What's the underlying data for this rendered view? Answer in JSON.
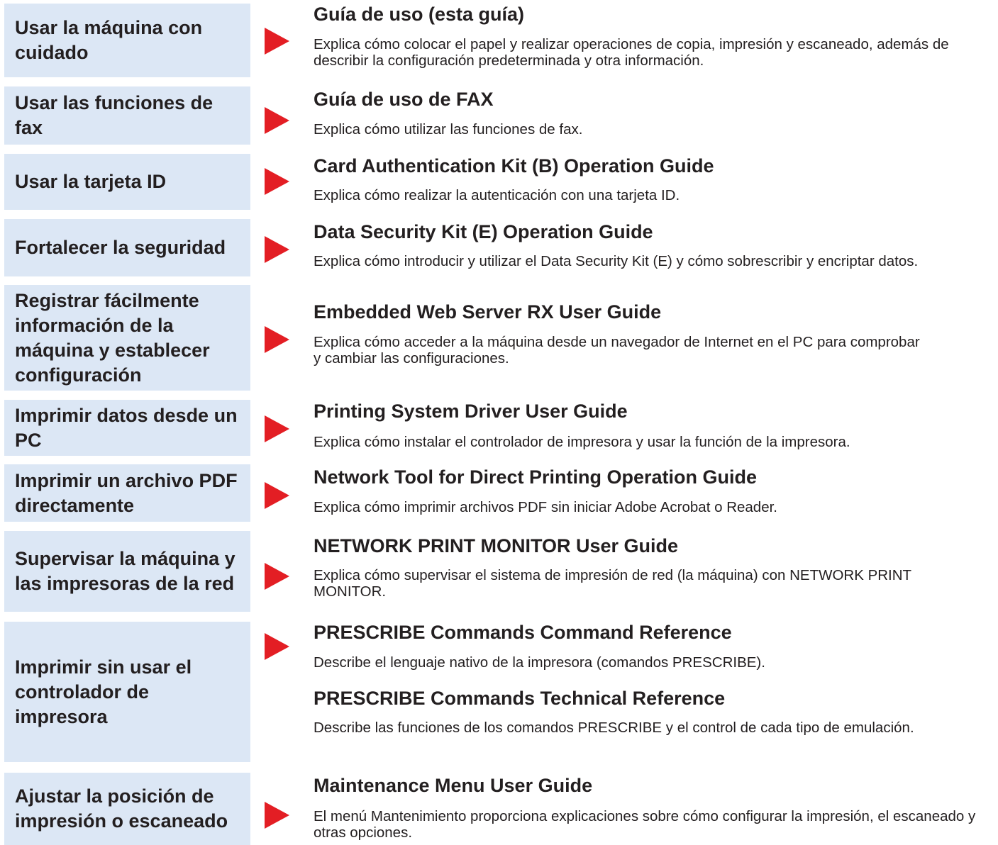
{
  "rows": [
    {
      "task": "Usar la máquina con cuidado",
      "guides": [
        {
          "title": "Guía de uso (esta guía)",
          "desc": "Explica cómo colocar el papel y realizar operaciones de copia, impresión y escaneado, además de describir la configuración predeterminada y otra información."
        }
      ]
    },
    {
      "task": "Usar las funciones de fax",
      "guides": [
        {
          "title": "Guía de uso de FAX",
          "desc": "Explica cómo utilizar las funciones de fax."
        }
      ]
    },
    {
      "task": "Usar la tarjeta ID",
      "guides": [
        {
          "title": "Card Authentication Kit (B) Operation Guide",
          "desc": "Explica cómo realizar la autenticación con una tarjeta ID."
        }
      ]
    },
    {
      "task": "Fortalecer la seguridad",
      "guides": [
        {
          "title": "Data Security Kit (E) Operation Guide",
          "desc": "Explica cómo introducir y utilizar el Data Security Kit (E) y cómo sobrescribir y encriptar datos."
        }
      ]
    },
    {
      "task": "Registrar fácilmente información de la máquina y establecer configuración",
      "guides": [
        {
          "title": "Embedded Web Server RX User Guide",
          "desc": "Explica cómo acceder a la máquina desde un navegador de Internet en el PC para comprobar y cambiar las configuraciones."
        }
      ]
    },
    {
      "task": "Imprimir datos desde un PC",
      "guides": [
        {
          "title": "Printing System Driver User Guide",
          "desc": "Explica cómo instalar el controlador de impresora y usar la función de la impresora."
        }
      ]
    },
    {
      "task": "Imprimir un archivo PDF directamente",
      "guides": [
        {
          "title": "Network Tool for Direct Printing Operation Guide",
          "desc": "Explica cómo imprimir archivos PDF sin iniciar Adobe Acrobat o Reader."
        }
      ]
    },
    {
      "task": "Supervisar la máquina y las impresoras de la red",
      "guides": [
        {
          "title": "NETWORK PRINT MONITOR User Guide",
          "desc": "Explica cómo supervisar el sistema de impresión de red (la máquina) con NETWORK PRINT MONITOR."
        }
      ]
    },
    {
      "task": "Imprimir sin usar el controlador de impresora",
      "guides": [
        {
          "title": "PRESCRIBE Commands Command Reference",
          "desc": "Describe el lenguaje nativo de la impresora (comandos PRESCRIBE)."
        },
        {
          "title": "PRESCRIBE Commands Technical Reference",
          "desc": "Describe las funciones de los comandos PRESCRIBE y el control de cada tipo de emulación."
        }
      ]
    },
    {
      "task": "Ajustar la posición de impresión o escaneado",
      "guides": [
        {
          "title": "Maintenance Menu User Guide",
          "desc": "El menú Mantenimiento proporciona explicaciones sobre cómo configurar la impresión, el escaneado y otras opciones."
        }
      ]
    }
  ],
  "colors": {
    "task_bg": "#dce7f5",
    "arrow": "#e31e24",
    "text": "#231f20"
  }
}
